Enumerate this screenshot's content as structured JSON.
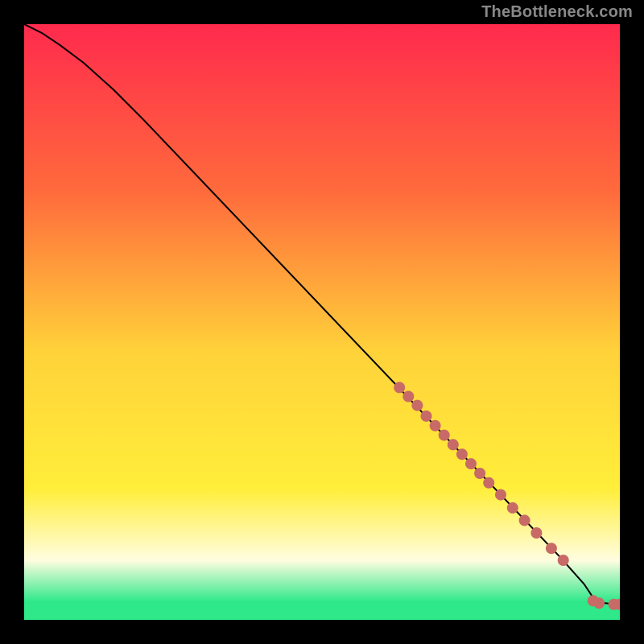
{
  "watermark": "TheBottleneck.com",
  "colors": {
    "page_bg": "#000000",
    "gradient_top": "#ff2a4d",
    "gradient_mid_upper": "#ff6a3c",
    "gradient_mid": "#ffd23a",
    "gradient_yellow": "#ffee3a",
    "gradient_pale": "#fffde0",
    "gradient_green": "#2ee88a",
    "curve_stroke": "#000000",
    "marker_fill": "#c86a66",
    "marker_stroke": "#b05a56"
  },
  "chart_data": {
    "type": "line",
    "title": "",
    "xlabel": "",
    "ylabel": "",
    "xlim": [
      0,
      100
    ],
    "ylim": [
      0,
      100
    ],
    "series": [
      {
        "name": "bottleneck-curve",
        "x": [
          0,
          3,
          6,
          10,
          15,
          20,
          30,
          40,
          50,
          60,
          70,
          80,
          90,
          94,
          96,
          100
        ],
        "y": [
          100,
          98.5,
          96.5,
          93.5,
          89,
          84,
          73.5,
          63,
          52.5,
          42,
          31.5,
          21,
          10.5,
          6,
          3,
          2.5
        ]
      }
    ],
    "markers": [
      {
        "x": 63,
        "y": 39
      },
      {
        "x": 64.5,
        "y": 37.5
      },
      {
        "x": 66,
        "y": 36
      },
      {
        "x": 67.5,
        "y": 34.2
      },
      {
        "x": 69,
        "y": 32.6
      },
      {
        "x": 70.5,
        "y": 31
      },
      {
        "x": 72,
        "y": 29.4
      },
      {
        "x": 73.5,
        "y": 27.8
      },
      {
        "x": 75,
        "y": 26.2
      },
      {
        "x": 76.5,
        "y": 24.6
      },
      {
        "x": 78,
        "y": 23
      },
      {
        "x": 80,
        "y": 21
      },
      {
        "x": 82,
        "y": 18.8
      },
      {
        "x": 84,
        "y": 16.7
      },
      {
        "x": 86,
        "y": 14.6
      },
      {
        "x": 88.5,
        "y": 12
      },
      {
        "x": 90.5,
        "y": 10
      },
      {
        "x": 95.5,
        "y": 3.2
      },
      {
        "x": 96.5,
        "y": 2.8
      },
      {
        "x": 99,
        "y": 2.6
      },
      {
        "x": 100,
        "y": 2.6
      }
    ]
  }
}
